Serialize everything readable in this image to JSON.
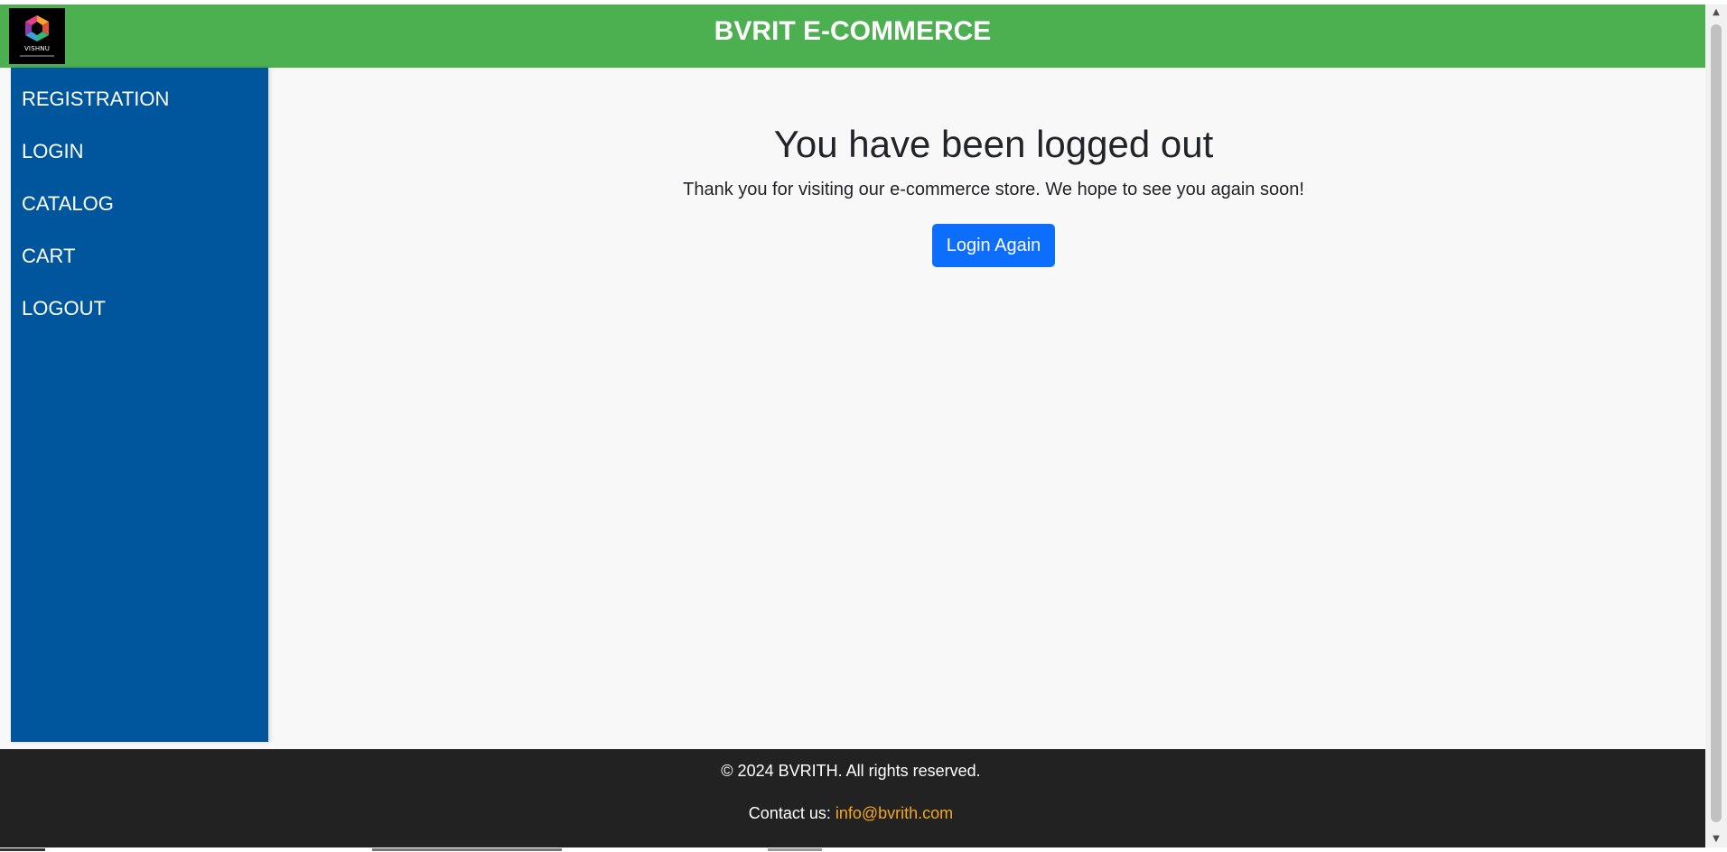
{
  "header": {
    "title": "BVRIT E-COMMERCE",
    "logo_text": "VISHNU"
  },
  "sidebar": {
    "items": [
      {
        "label": "REGISTRATION"
      },
      {
        "label": "LOGIN"
      },
      {
        "label": "CATALOG"
      },
      {
        "label": "CART"
      },
      {
        "label": "LOGOUT"
      }
    ]
  },
  "main": {
    "title": "You have been logged out",
    "message": "Thank you for visiting our e-commerce store. We hope to see you again soon!",
    "button_label": "Login Again"
  },
  "footer": {
    "copyright": "© 2024 BVRITH. All rights reserved.",
    "contact_label": "Contact us:",
    "contact_email": "info@bvrith.com"
  },
  "colors": {
    "header_bg": "#4CAF50",
    "sidebar_bg": "#00569D",
    "button_bg": "#0D6EFD",
    "footer_bg": "#222222",
    "link_color": "#F5A623"
  }
}
